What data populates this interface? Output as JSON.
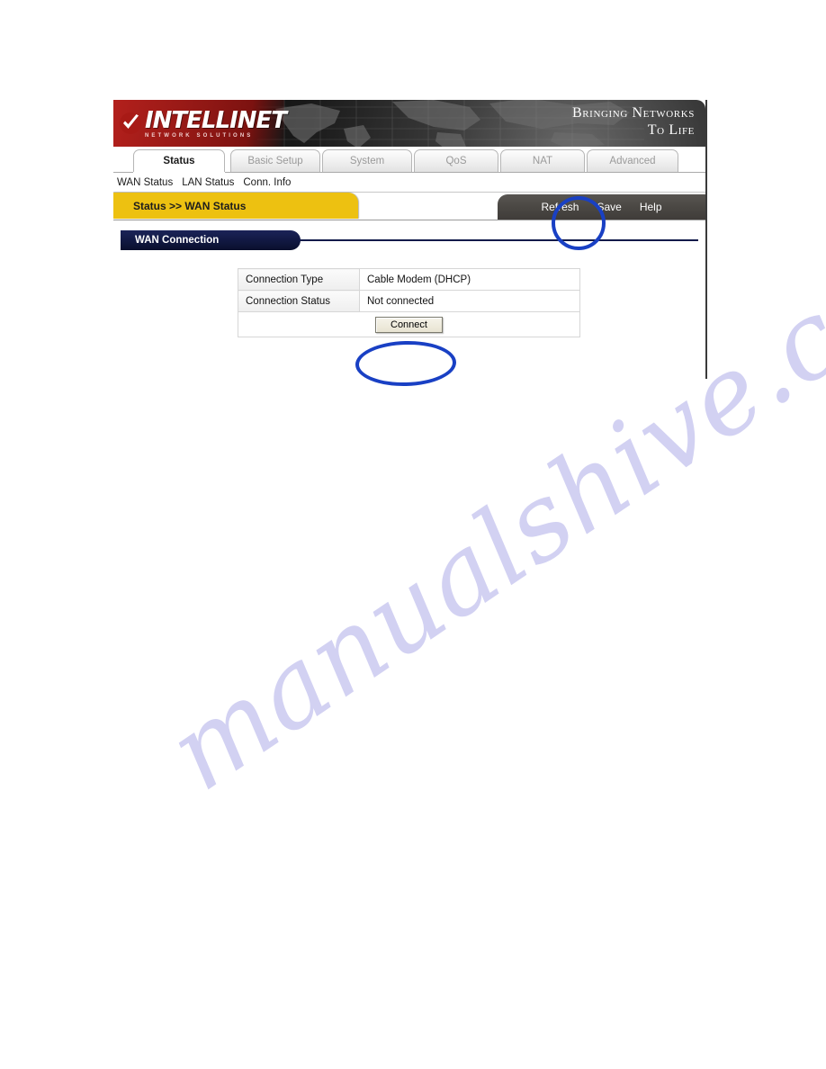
{
  "page": {
    "watermark_text": "manualshive.com"
  },
  "banner": {
    "logo_name": "INTELLINET",
    "logo_sub": "NETWORK SOLUTIONS",
    "logo_check_icon": "checkmark-icon",
    "world_map_icon": "world-map-icon",
    "tagline_line1": "Bringing Networks",
    "tagline_line2": "To Life"
  },
  "tabs": [
    {
      "label": "Status",
      "active": true
    },
    {
      "label": "Basic Setup",
      "active": false
    },
    {
      "label": "System",
      "active": false
    },
    {
      "label": "QoS",
      "active": false
    },
    {
      "label": "NAT",
      "active": false
    },
    {
      "label": "Advanced",
      "active": false
    }
  ],
  "subnav": [
    {
      "label": "WAN Status"
    },
    {
      "label": "LAN Status"
    },
    {
      "label": "Conn. Info"
    }
  ],
  "title_strip": {
    "breadcrumb": "Status >> WAN Status",
    "actions": [
      {
        "label": "Refresh"
      },
      {
        "label": "Save"
      },
      {
        "label": "Help"
      }
    ]
  },
  "section": {
    "heading": "WAN Connection"
  },
  "table": {
    "rows": [
      {
        "label": "Connection Type",
        "value": "Cable Modem (DHCP)"
      },
      {
        "label": "Connection Status",
        "value": "Not connected"
      }
    ],
    "action_button": "Connect"
  },
  "annotations": {
    "color": "#1940c4",
    "items": [
      {
        "target": "Save",
        "shape": "circle"
      },
      {
        "target": "Connect",
        "shape": "ellipse"
      }
    ]
  }
}
